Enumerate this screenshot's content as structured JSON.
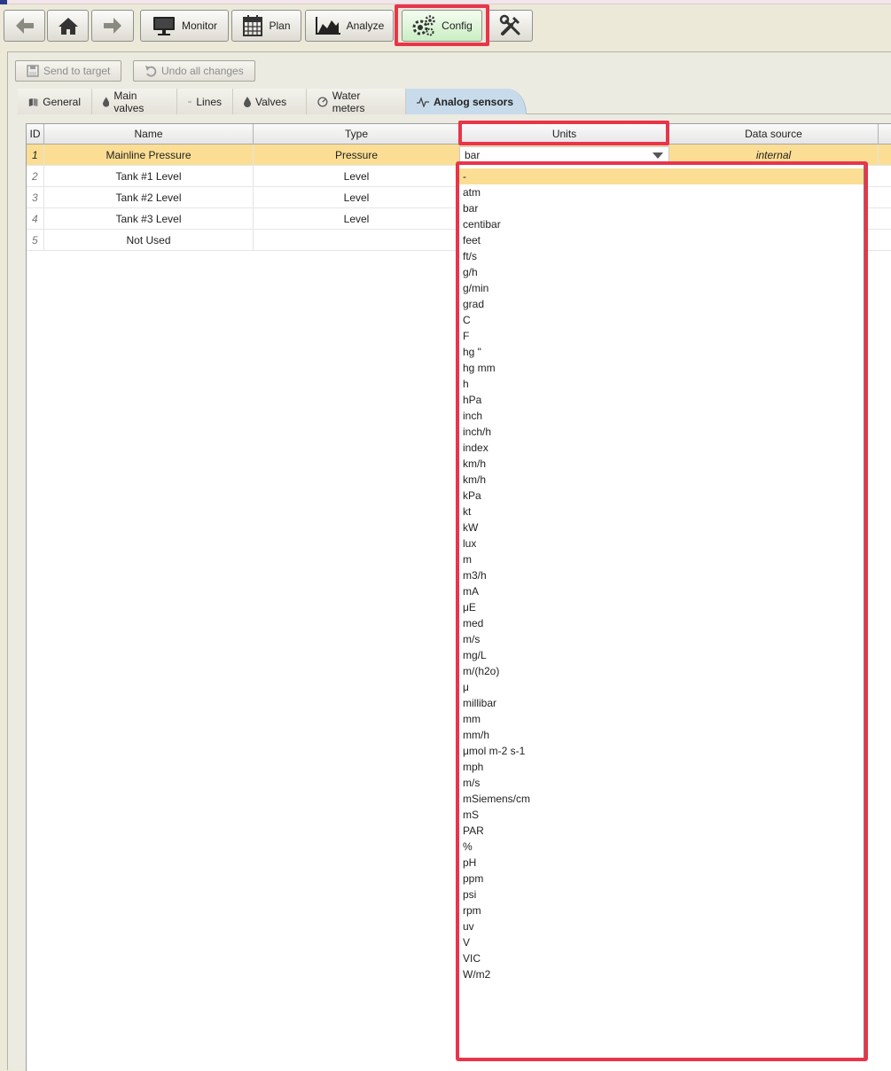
{
  "toolbar": {
    "monitor": "Monitor",
    "plan": "Plan",
    "analyze": "Analyze",
    "config": "Config"
  },
  "actions": {
    "send": "Send to target",
    "undo": "Undo all changes"
  },
  "tabs": [
    "General",
    "Main valves",
    "Lines",
    "Valves",
    "Water meters",
    "Analog sensors"
  ],
  "table": {
    "columns": [
      "ID",
      "Name",
      "Type",
      "Units",
      "Data source"
    ],
    "rows": [
      {
        "id": "1",
        "name": "Mainline Pressure",
        "type": "Pressure",
        "units": "bar",
        "source": "internal"
      },
      {
        "id": "2",
        "name": "Tank #1 Level",
        "type": "Level"
      },
      {
        "id": "3",
        "name": "Tank #2 Level",
        "type": "Level"
      },
      {
        "id": "4",
        "name": "Tank #3 Level",
        "type": "Level"
      },
      {
        "id": "5",
        "name": "Not Used",
        "type": ""
      }
    ]
  },
  "units_options": [
    "-",
    "atm",
    "bar",
    "centibar",
    "feet",
    "ft/s",
    "g/h",
    "g/min",
    "grad",
    "C",
    "F",
    "hg \"",
    "hg mm",
    "h",
    "hPa",
    "inch",
    "inch/h",
    "index",
    "km/h",
    "km/h",
    "kPa",
    "kt",
    "kW",
    "lux",
    "m",
    "m3/h",
    "mA",
    "μE",
    "med",
    "m/s",
    "mg/L",
    "m/(h2o)",
    "μ",
    "millibar",
    "mm",
    "mm/h",
    "μmol m-2 s-1",
    "mph",
    "m/s",
    "mSiemens/cm",
    "mS",
    "PAR",
    "%",
    "pH",
    "ppm",
    "psi",
    "rpm",
    "uv",
    "V",
    "VIC",
    "W/m2"
  ],
  "colors": {
    "highlight": "#e8354a",
    "selected_row": "#fbde93",
    "active_tab": "#c8dbeb",
    "active_button": "#cbeec4"
  }
}
